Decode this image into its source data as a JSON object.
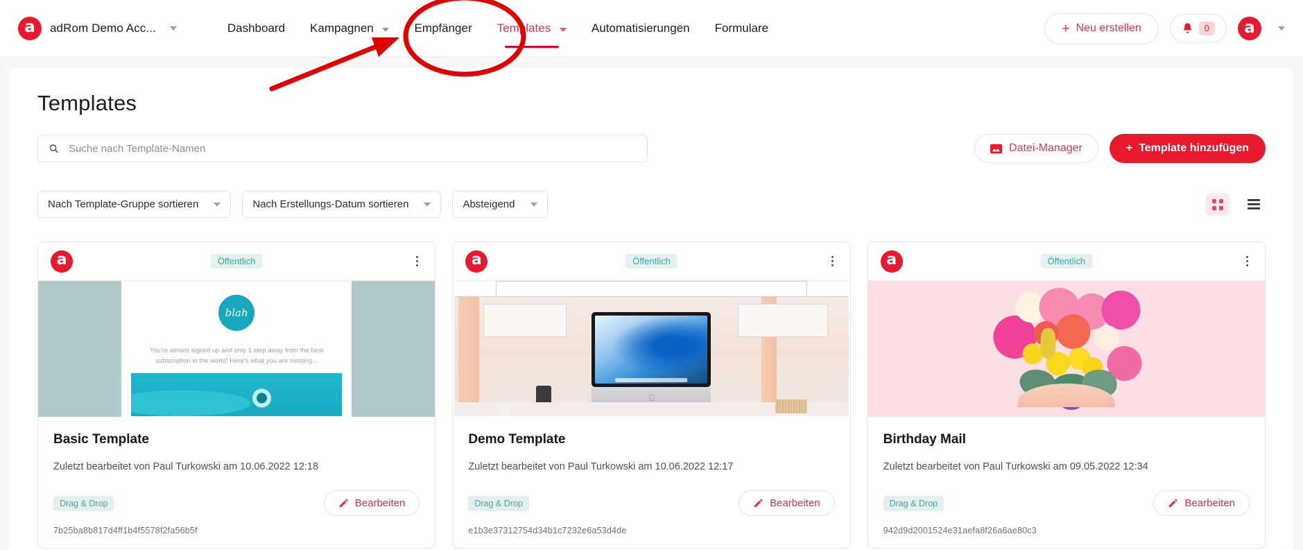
{
  "header": {
    "brand_icon": "adrom-logo-icon",
    "account_name": "adRom Demo Acc...",
    "nav_items": [
      {
        "label": "Dashboard",
        "has_caret": false,
        "active": false
      },
      {
        "label": "Kampagnen",
        "has_caret": true,
        "active": false
      },
      {
        "label": "Empfänger",
        "has_caret": false,
        "active": false
      },
      {
        "label": "Templates",
        "has_caret": true,
        "active": true
      },
      {
        "label": "Automatisierungen",
        "has_caret": false,
        "active": false
      },
      {
        "label": "Formulare",
        "has_caret": false,
        "active": false
      }
    ],
    "new_button_label": "Neu erstellen",
    "new_button_plus": "+",
    "notification_count": "0",
    "avatar_letter": "a"
  },
  "main": {
    "page_title": "Templates",
    "search": {
      "placeholder": "Suche nach Template-Namen",
      "value": ""
    },
    "file_manager_label": "Datei-Manager",
    "add_template_label": "Template hinzufügen",
    "add_template_plus": "+",
    "filters": [
      {
        "label": "Nach Template-Gruppe sortieren"
      },
      {
        "label": "Nach Erstellungs-Datum sortieren"
      },
      {
        "label": "Absteigend"
      }
    ],
    "view_modes": [
      {
        "name": "grid",
        "active": true
      },
      {
        "name": "list",
        "active": false
      }
    ],
    "cards": [
      {
        "badge": "Öffentlich",
        "title": "Basic Template",
        "subtitle": "Zuletzt bearbeitet von Paul Turkowski am 10.06.2022 12:18",
        "tag": "Drag & Drop",
        "edit_label": "Bearbeiten",
        "hash": "7b25ba8b817d4ff1b4f5578f2fa56b5f",
        "thumb_kind": "newsletter-blah",
        "thumb_logo_text": "blah",
        "thumb_body_text": "You're almost signed up and only 1 step away from the best subscription in the world! Here's what you are missing..."
      },
      {
        "badge": "Öffentlich",
        "title": "Demo Template",
        "subtitle": "Zuletzt bearbeitet von Paul Turkowski am 10.06.2022 12:17",
        "tag": "Drag & Drop",
        "edit_label": "Bearbeiten",
        "hash": "e1b3e37312754d34b1c7232e6a53d4de",
        "thumb_kind": "desk-imac"
      },
      {
        "badge": "Öffentlich",
        "title": "Birthday Mail",
        "subtitle": "Zuletzt bearbeitet von Paul Turkowski am 09.05.2022 12:34",
        "tag": "Drag & Drop",
        "edit_label": "Bearbeiten",
        "hash": "942d9d2001524e31aefa8f26a6ae80c3",
        "thumb_kind": "flower-heart"
      }
    ]
  },
  "annotation": {
    "shape": "ellipse-and-arrow",
    "target": "Templates",
    "color": "#e00000"
  },
  "colors": {
    "brand_red": "#e8192c",
    "accent_red": "#e0304b",
    "teal_badge_text": "#3da49d",
    "teal_badge_bg": "#e4f1f0",
    "page_bg": "#faf7f7"
  }
}
